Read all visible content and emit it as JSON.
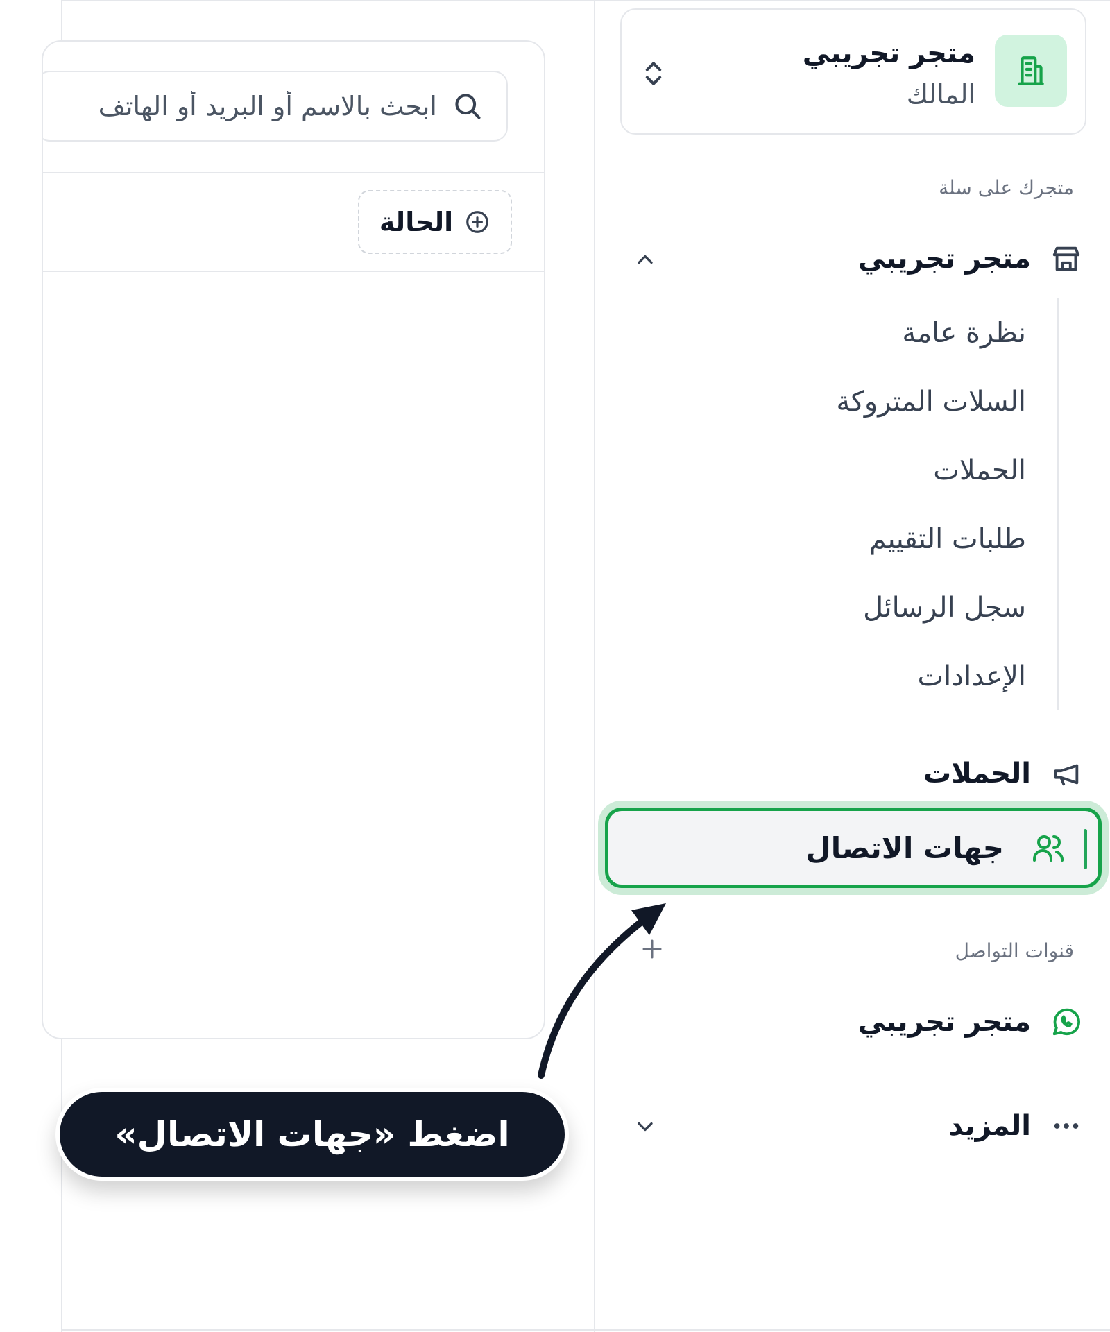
{
  "search": {
    "placeholder": "ابحث بالاسم أو البريد أو الهاتف"
  },
  "filter": {
    "status_label": "الحالة"
  },
  "store_switcher": {
    "name": "متجر تجريبي",
    "role": "المالك"
  },
  "sidebar": {
    "section_store": "متجرك على سلة",
    "store_group": {
      "label": "متجر تجريبي",
      "items": [
        {
          "label": "نظرة عامة"
        },
        {
          "label": "السلات المتروكة"
        },
        {
          "label": "الحملات"
        },
        {
          "label": "طلبات التقييم"
        },
        {
          "label": "سجل الرسائل"
        },
        {
          "label": "الإعدادات"
        }
      ]
    },
    "campaigns": {
      "label": "الحملات"
    },
    "contacts": {
      "label": "جهات الاتصال"
    },
    "section_channels": "قنوات التواصل",
    "channel": {
      "label": "متجر تجريبي"
    },
    "more": {
      "label": "المزيد"
    }
  },
  "annotation": {
    "text": "اضغط «جهات الاتصال»"
  },
  "colors": {
    "accent": "#16a34a",
    "accent_light": "#d1f3df",
    "callout_bg": "#111827",
    "active_bg": "#f3f4f6"
  }
}
